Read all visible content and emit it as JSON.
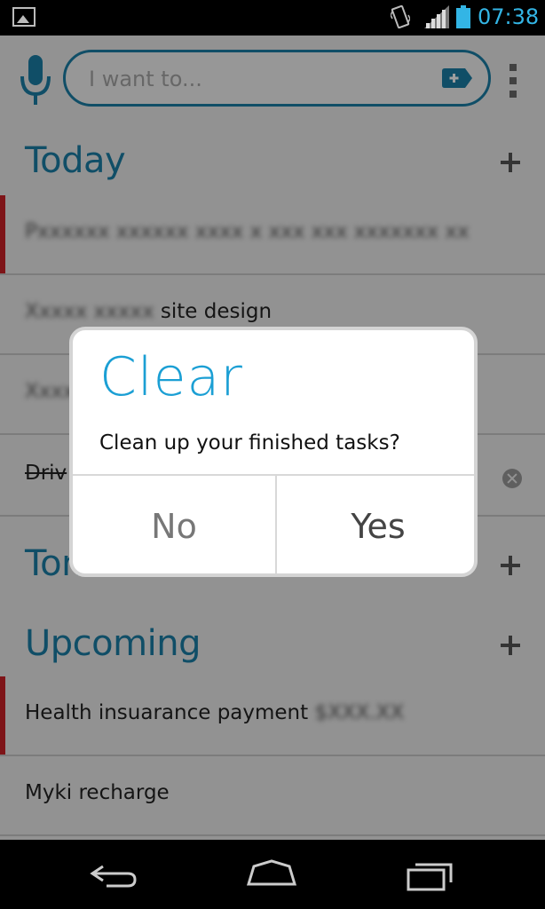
{
  "status_bar": {
    "time": "07:38",
    "icons": [
      "gallery-icon",
      "vibrate-icon",
      "signal-icon",
      "battery-icon"
    ],
    "accent_color": "#33b5e5"
  },
  "search": {
    "placeholder": "I want to..."
  },
  "sections": {
    "today": {
      "title": "Today"
    },
    "tomorrow": {
      "title": "Tomorrow"
    },
    "upcoming": {
      "title": "Upcoming"
    }
  },
  "tasks": {
    "today_1": {
      "text_blurred": "Pxxxxxx xxxxxx xxxx x xxx xxx xxxxxxx xx"
    },
    "today_2": {
      "text_blurred": "Xxxxx xxxxx",
      "text": "site design"
    },
    "today_3": {
      "text_blurred": "Xxxx"
    },
    "today_4": {
      "text": "Driv"
    },
    "upcoming_1": {
      "text": "Health insuarance payment",
      "text_blurred": "$XXX.XX"
    },
    "upcoming_2": {
      "text": "Myki recharge"
    }
  },
  "dialog": {
    "title": "Clear",
    "message": "Clean up your finished tasks?",
    "no_label": "No",
    "yes_label": "Yes"
  },
  "colors": {
    "brand": "#1b7fa6",
    "flag": "#cc2127",
    "dialog_title": "#1b9fd4"
  }
}
